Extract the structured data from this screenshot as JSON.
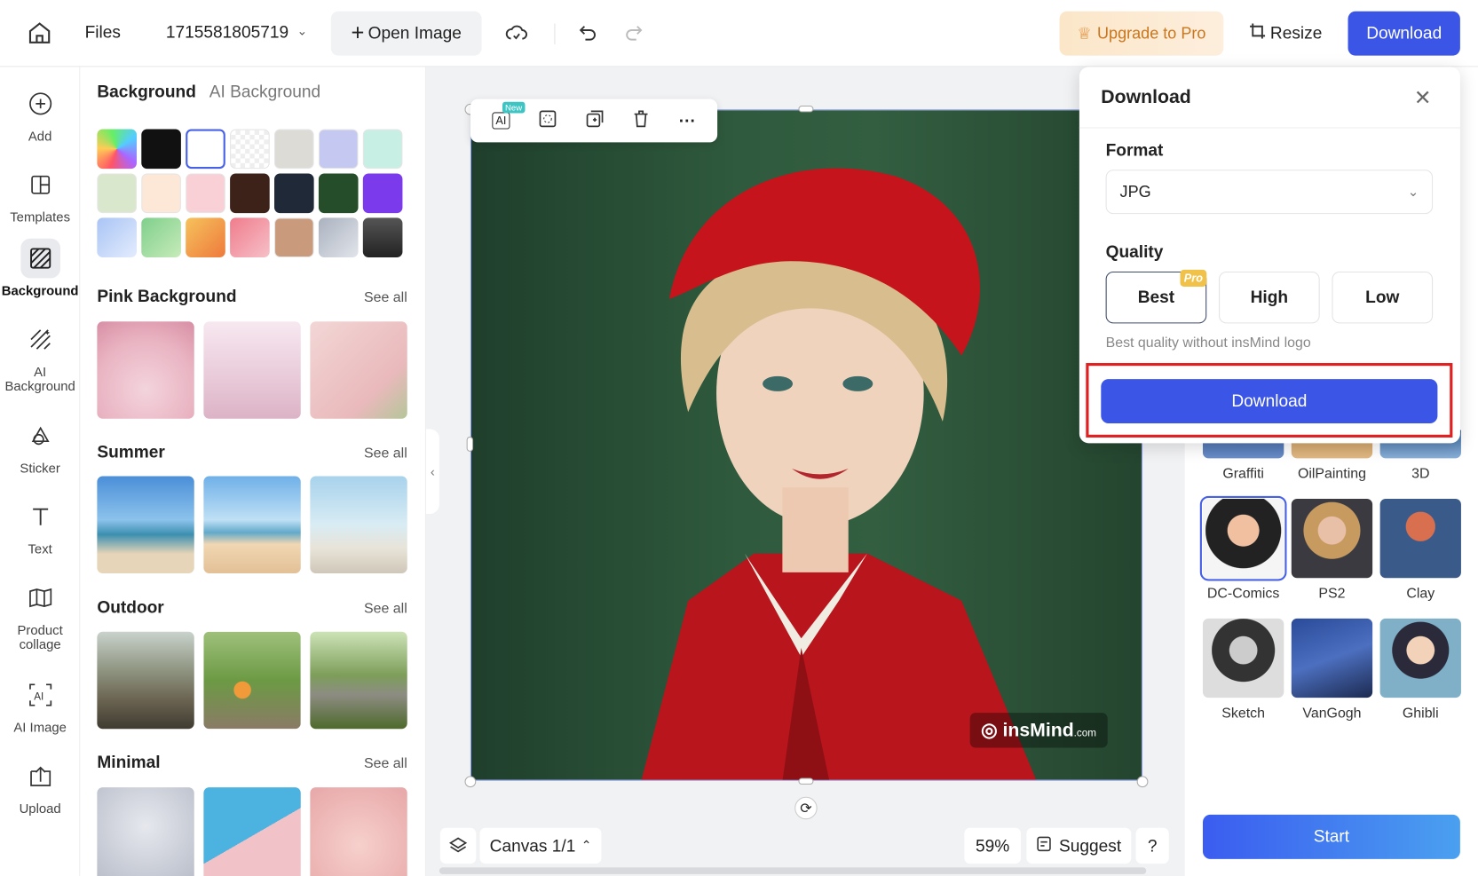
{
  "topbar": {
    "files": "Files",
    "filename": "1715581805719",
    "open_image": "Open Image",
    "upgrade": "Upgrade to Pro",
    "resize": "Resize",
    "download": "Download"
  },
  "leftnav": [
    {
      "label": "Add",
      "icon": "plus-circle-icon"
    },
    {
      "label": "Templates",
      "icon": "templates-icon"
    },
    {
      "label": "Background",
      "icon": "background-icon",
      "active": true
    },
    {
      "label": "AI Background",
      "icon": "ai-background-icon"
    },
    {
      "label": "Sticker",
      "icon": "sticker-icon"
    },
    {
      "label": "Text",
      "icon": "text-icon"
    },
    {
      "label": "Product collage",
      "icon": "collage-icon"
    },
    {
      "label": "AI Image",
      "icon": "ai-image-icon"
    },
    {
      "label": "Upload",
      "icon": "upload-icon"
    }
  ],
  "panel": {
    "tabs": [
      "Background",
      "AI Background"
    ],
    "swatches": [
      "rainbow",
      "#111111",
      "#ffffff",
      "transparent",
      "#dddbd6",
      "#c5c8f0",
      "#c8efe4",
      "#d9e8cc",
      "#fde8d8",
      "#f8d0d6",
      "#3d2219",
      "#1f2937",
      "#254d2a",
      "#7c3aed",
      "light-blue-gradient",
      "green-gradient",
      "orange-gradient",
      "pink-gradient",
      "#c99a7c",
      "silver-gradient",
      "dark-gradient"
    ],
    "sections": [
      {
        "title": "Pink Background",
        "see_all": "See all"
      },
      {
        "title": "Summer",
        "see_all": "See all"
      },
      {
        "title": "Outdoor",
        "see_all": "See all"
      },
      {
        "title": "Minimal",
        "see_all": "See all"
      }
    ]
  },
  "canvas": {
    "toolbar_badge": "New",
    "watermark": "insMind",
    "watermark_suffix": ".com",
    "canvas_label": "Canvas 1/1",
    "zoom": "59%",
    "suggest": "Suggest",
    "help": "?"
  },
  "styles": {
    "row_top": [
      "Graffiti",
      "OilPainting",
      "3D"
    ],
    "items": [
      "DC-Comics",
      "PS2",
      "Clay",
      "Sketch",
      "VanGogh",
      "Ghibli"
    ],
    "start": "Start"
  },
  "download_popup": {
    "title": "Download",
    "format_label": "Format",
    "format_value": "JPG",
    "quality_label": "Quality",
    "quality_options": [
      "Best",
      "High",
      "Low"
    ],
    "selected_quality": "Best",
    "pro_badge": "Pro",
    "note": "Best quality without insMind logo",
    "download_button": "Download"
  },
  "colors": {
    "accent": "#3b55e6",
    "highlight": "#e02020"
  }
}
